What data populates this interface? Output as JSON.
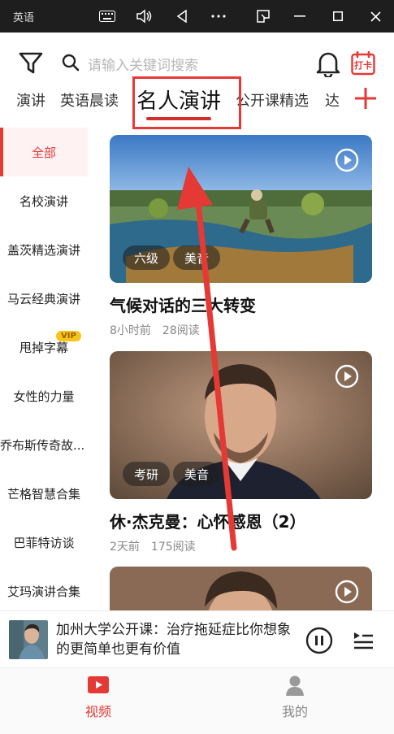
{
  "window": {
    "title": "英语",
    "icons": [
      "keyboard-icon",
      "volume-icon",
      "back-icon",
      "more-icon",
      "screenshot-icon",
      "minimize-icon",
      "maximize-icon",
      "close-icon"
    ]
  },
  "search": {
    "placeholder": "请输入关键词搜索",
    "checkin_label": "打卡"
  },
  "tabs": [
    {
      "label": "演讲"
    },
    {
      "label": "英语晨读"
    },
    {
      "label": "名人演讲",
      "active": true
    },
    {
      "label": "公开课精选"
    },
    {
      "label": "达"
    }
  ],
  "sidebar": {
    "items": [
      {
        "label": "全部",
        "active": true
      },
      {
        "label": "名校演讲"
      },
      {
        "label": "盖茨精选演讲"
      },
      {
        "label": "马云经典演讲"
      },
      {
        "label": "甩掉字幕",
        "badge": "VIP"
      },
      {
        "label": "女性的力量"
      },
      {
        "label": "乔布斯传奇故..."
      },
      {
        "label": "芒格智慧合集"
      },
      {
        "label": "巴菲特访谈"
      },
      {
        "label": "艾玛演讲合集"
      }
    ]
  },
  "cards": [
    {
      "title": "气候对话的三大转变",
      "time": "8小时前",
      "reads": "28阅读",
      "tags": [
        "六级",
        "美音"
      ],
      "scene": "landscape"
    },
    {
      "title": "休·杰克曼：心怀感恩（2）",
      "time": "2天前",
      "reads": "175阅读",
      "tags": [
        "考研",
        "美音"
      ],
      "scene": "portrait"
    },
    {
      "title": "",
      "time": "",
      "reads": "",
      "tags": [],
      "scene": "portrait"
    }
  ],
  "player": {
    "title": "加州大学公开课：治疗拖延症比你想象的更简单也更有价值"
  },
  "bottom_nav": {
    "items": [
      {
        "label": "视频",
        "active": true
      },
      {
        "label": "我的"
      }
    ]
  },
  "colors": {
    "accent": "#e53935",
    "vip": "#f5c518",
    "muted": "#888888"
  }
}
